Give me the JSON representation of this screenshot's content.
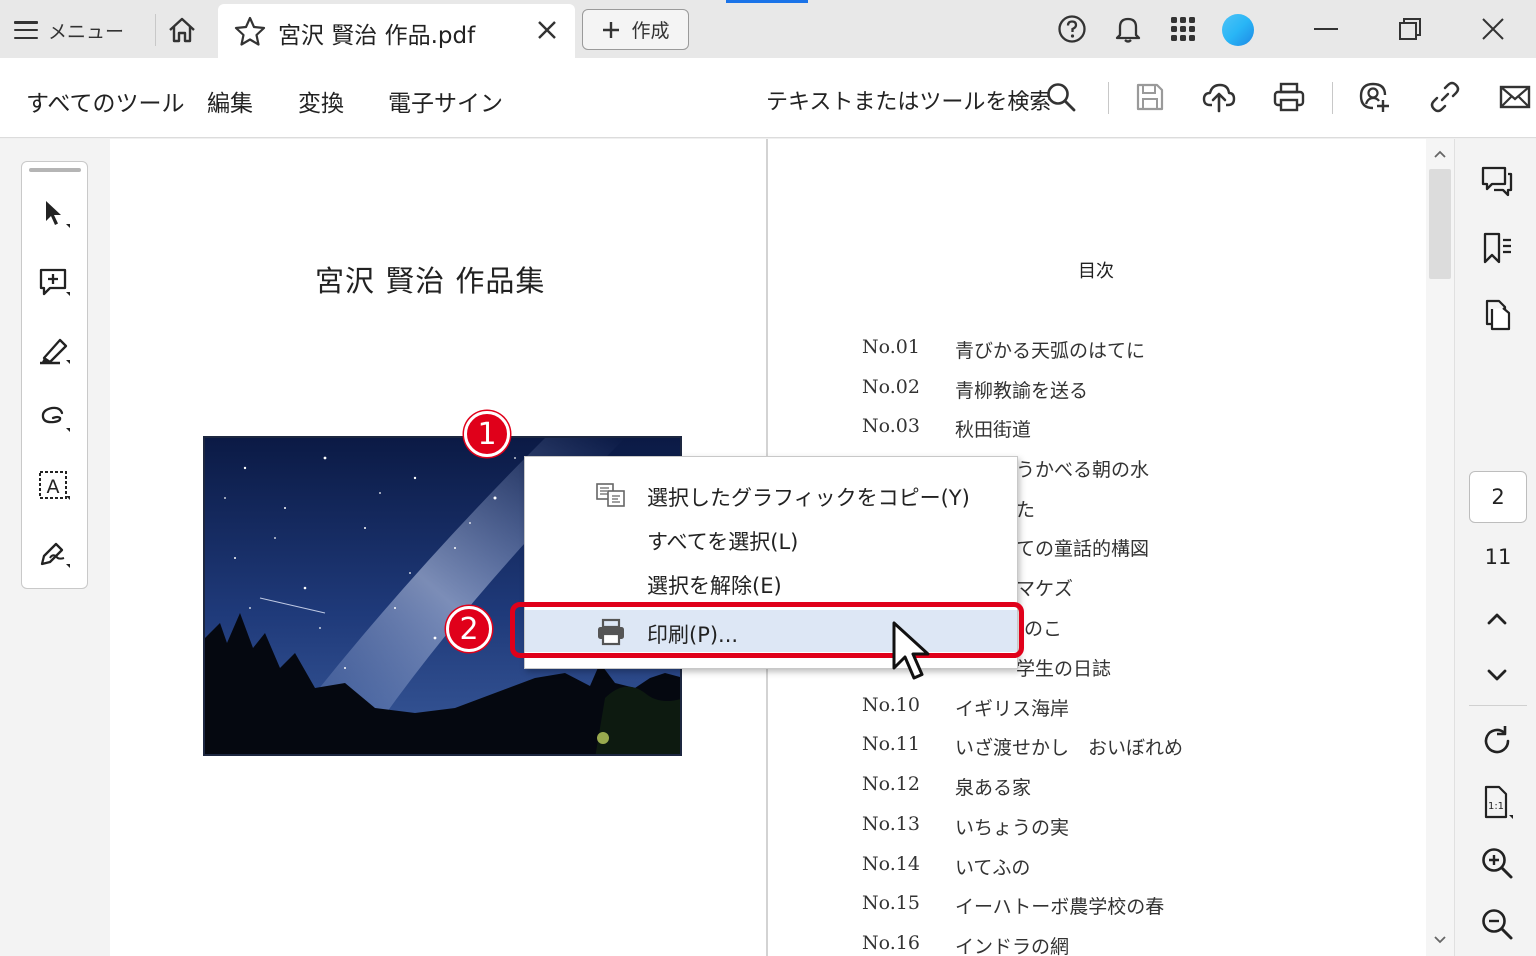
{
  "titlebar": {
    "menu_label": "メニュー",
    "tab_title": "宮沢 賢治 作品.pdf",
    "create_label": "作成"
  },
  "toolbar": {
    "menus": [
      "すべてのツール",
      "編集",
      "変換",
      "電子サイン"
    ],
    "search_label": "テキストまたはツールを検索"
  },
  "document": {
    "title": "宮沢 賢治 作品集",
    "toc_heading": "目次",
    "toc": [
      {
        "no": "No.01",
        "name": "青びかる天弧のはてに"
      },
      {
        "no": "No.02",
        "name": "青柳教諭を送る"
      },
      {
        "no": "No.03",
        "name": "秋田街道"
      },
      {
        "no": "",
        "name": "うかべる朝の水"
      },
      {
        "no": "",
        "name": "た"
      },
      {
        "no": "",
        "name": "ての童話的構図"
      },
      {
        "no": "",
        "name": "マケズ"
      },
      {
        "no": "",
        "name": "のこ"
      },
      {
        "no": "",
        "name": "学生の日誌"
      },
      {
        "no": "No.10",
        "name": "イギリス海岸"
      },
      {
        "no": "No.11",
        "name": "いざ渡せかし　おいぼれめ"
      },
      {
        "no": "No.12",
        "name": "泉ある家"
      },
      {
        "no": "No.13",
        "name": "いちょうの実"
      },
      {
        "no": "No.14",
        "name": "いてふの"
      },
      {
        "no": "No.15",
        "name": "イーハトーボ農学校の春"
      },
      {
        "no": "No.16",
        "name": "インドラの網"
      }
    ]
  },
  "context_menu": {
    "items": [
      {
        "label": "選択したグラフィックをコピー(Y)",
        "icon": "copy-graphic-icon"
      },
      {
        "label": "すべてを選択(L)",
        "icon": ""
      },
      {
        "label": "選択を解除(E)",
        "icon": ""
      },
      {
        "label": "印刷(P)...",
        "icon": "print-icon"
      }
    ]
  },
  "annotations": {
    "step1": "1",
    "step2": "2",
    "color": "#e0001a"
  },
  "navigation": {
    "current_page": "2",
    "total_pages": "11"
  }
}
